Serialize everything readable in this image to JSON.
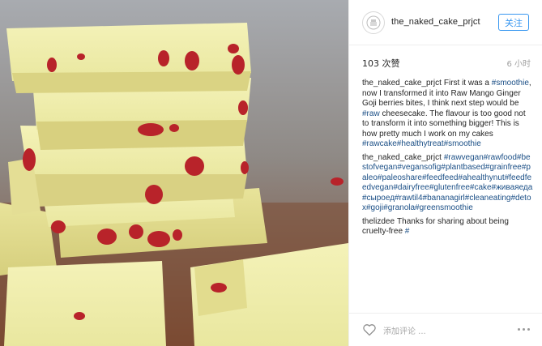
{
  "post": {
    "username": "the_naked_cake_prjct",
    "follow_label": "关注",
    "likes": "103 次赞",
    "time_ago": "6 小时"
  },
  "comments": [
    {
      "user": "the_naked_cake_prjct",
      "segments": [
        {
          "text": "First it was a ",
          "tag": false
        },
        {
          "text": "#smoothie",
          "tag": true
        },
        {
          "text": ", now I transformed it into Raw Mango Ginger Goji berries bites, I think next step would be ",
          "tag": false
        },
        {
          "text": "#raw",
          "tag": true
        },
        {
          "text": " cheesecake. The flavour is too good not to transform it into something bigger! This is how pretty much I work on my cakes ",
          "tag": false
        },
        {
          "text": "#rawcake#healthytreat#smoothie",
          "tag": true
        }
      ]
    },
    {
      "user": "the_naked_cake_prjct",
      "segments": [
        {
          "text": "#rawvegan#rawfood#bestofvegan#vegansofig#plantbased#grainfree#paleo#paleoshare#feedfeed#ahealthynut#feedfeedvegan#dairyfree#glutenfree#cake#живаяеда#сыроед#rawtil4#bananagirl#cleaneating#detox#goji#granola#greensmoothie",
          "tag": true
        }
      ]
    },
    {
      "user": "thelizdee",
      "segments": [
        {
          "text": "Thanks for sharing about being cruelty-free ",
          "tag": false
        },
        {
          "text": "#",
          "tag": true
        }
      ]
    }
  ],
  "footer": {
    "add_comment_placeholder": "添加评论 ..."
  },
  "icons": {
    "like": "heart-icon",
    "more": "more-options-icon",
    "avatar": "cake-logo-icon"
  },
  "colors": {
    "accent": "#3897f0",
    "hashtag": "#1b4f86",
    "text": "#262626",
    "muted": "#a0a0a0"
  }
}
